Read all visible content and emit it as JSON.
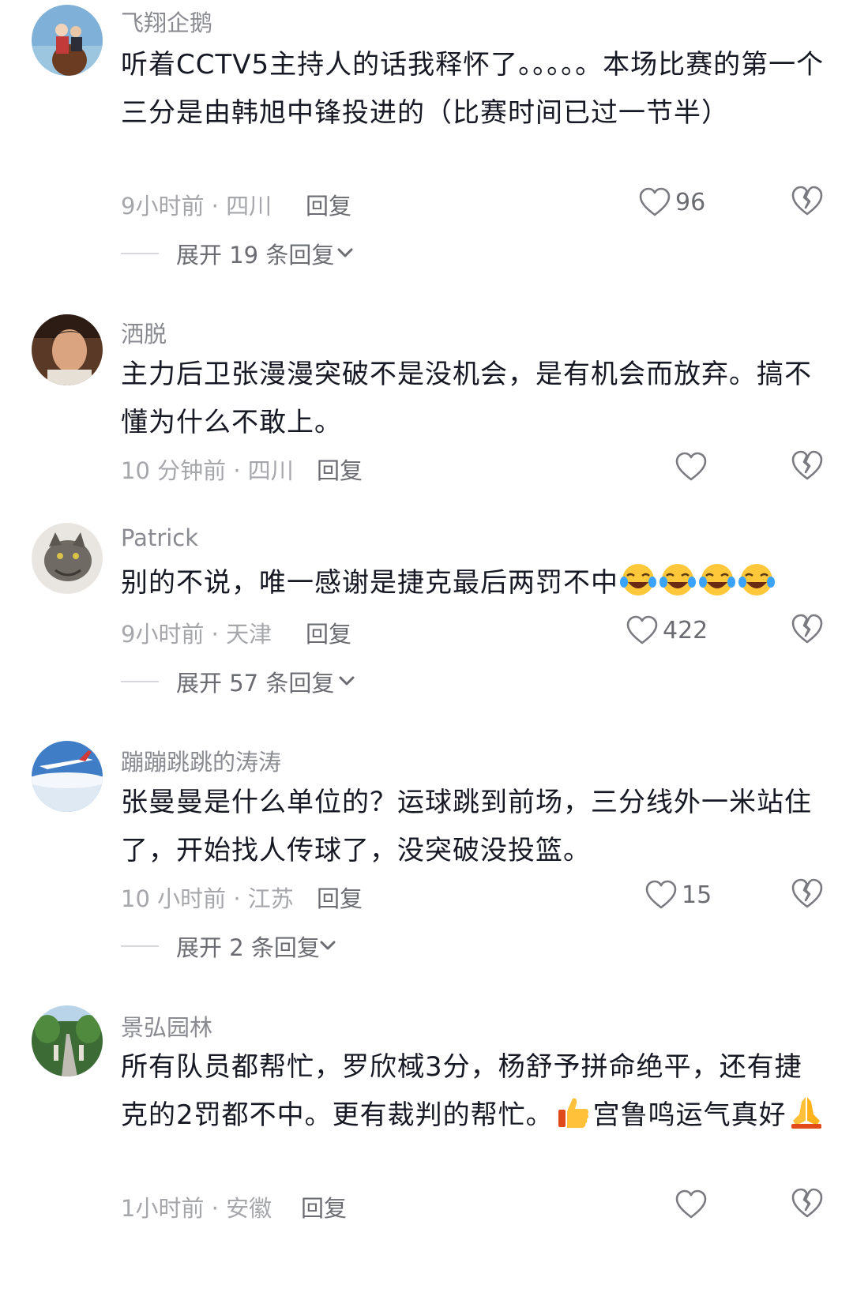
{
  "comments": [
    {
      "username": "飞翔企鹅",
      "text": "听着CCTV5主持人的话我释怀了。。。。。本场比赛的第一个三分是由韩旭中锋投进的（比赛时间已过一节半）",
      "time_location": "9小时前 · 四川",
      "reply_label": "回复",
      "likes": "96",
      "expand_label": "展开 19 条回复"
    },
    {
      "username": "洒脱",
      "text": "主力后卫张漫漫突破不是没机会，是有机会而放弃。搞不懂为什么不敢上。",
      "time_location": "10 分钟前 · 四川",
      "reply_label": "回复",
      "likes": ""
    },
    {
      "username": "Patrick",
      "text": "别的不说，唯一感谢是捷克最后两罚不中",
      "emojis": [
        "laugh-cry-emoji",
        "laugh-cry-emoji",
        "laugh-cry-emoji",
        "laugh-cry-emoji"
      ],
      "time_location": "9小时前 · 天津",
      "reply_label": "回复",
      "likes": "422",
      "expand_label": "展开 57 条回复"
    },
    {
      "username": "蹦蹦跳跳的涛涛",
      "text": "张曼曼是什么单位的？运球跳到前场，三分线外一米站住了，开始找人传球了，没突破没投篮。",
      "time_location": "10 小时前 · 江苏",
      "reply_label": "回复",
      "likes": "15",
      "expand_label": "展开 2 条回复"
    },
    {
      "username": "景弘园林",
      "text_part1": "所有队员都帮忙，罗欣棫3分，杨舒予拼命绝平，还有捷克的2罚都不中。更有裁判的帮忙。",
      "text_part2": "宫鲁鸣运气真好",
      "emojis": [
        "thumbs-up-emoji",
        "praying-hands-emoji"
      ],
      "time_location": "1小时前 · 安徽",
      "reply_label": "回复",
      "likes": ""
    }
  ],
  "colors": {
    "text": "#161823",
    "username": "#8a8b91",
    "meta": "#a6a7ab",
    "action": "#6b6c72"
  }
}
